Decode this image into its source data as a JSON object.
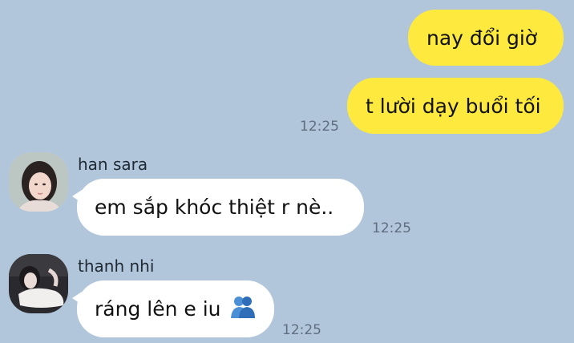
{
  "messages": [
    {
      "type": "outgoing",
      "text": "nay đổi giờ"
    },
    {
      "type": "outgoing",
      "text": "t lười dạy buổi tối",
      "time": "12:25"
    },
    {
      "type": "incoming",
      "sender": "han sara",
      "text": "em sắp khóc thiệt r nè..",
      "time": "12:25"
    },
    {
      "type": "incoming",
      "sender": "thanh nhi",
      "text": "ráng lên e iu",
      "emoji": "people-hugging-icon",
      "time": "12:25"
    }
  ],
  "colors": {
    "background": "#b1c5db",
    "outgoing_bubble": "#fee93f",
    "incoming_bubble": "#ffffff",
    "timestamp": "#5f6f7f"
  }
}
